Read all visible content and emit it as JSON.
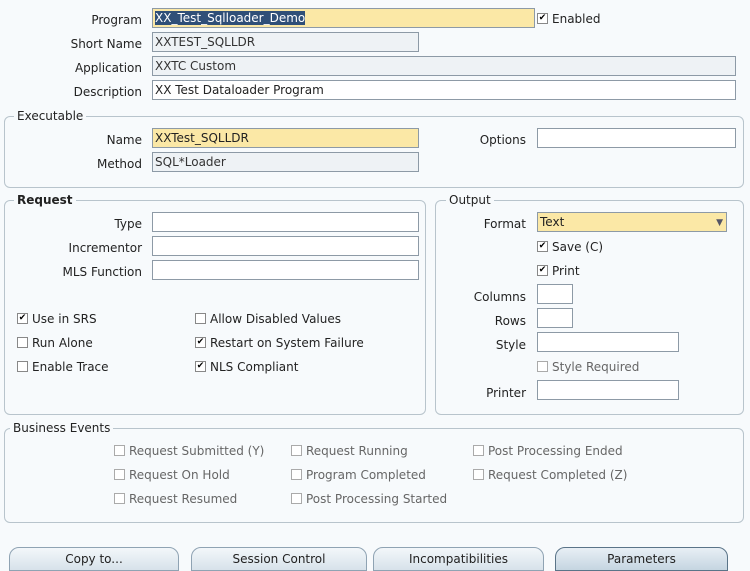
{
  "program": {
    "program_label": "Program",
    "program_value": "XX_Test_Sqlloader_Demo",
    "enabled_label": "Enabled",
    "enabled_checked": true,
    "short_name_label": "Short Name",
    "short_name_value": "XXTEST_SQLLDR",
    "application_label": "Application",
    "application_value": "XXTC Custom",
    "description_label": "Description",
    "description_value": "XX Test Dataloader Program"
  },
  "executable": {
    "title": "Executable",
    "name_label": "Name",
    "name_value": "XXTest_SQLLDR",
    "options_label": "Options",
    "options_value": "",
    "method_label": "Method",
    "method_value": "SQL*Loader"
  },
  "request": {
    "title": "Request",
    "type_label": "Type",
    "type_value": "",
    "incrementor_label": "Incrementor",
    "incrementor_value": "",
    "mls_label": "MLS Function",
    "mls_value": "",
    "checkboxes": {
      "use_in_srs": "Use in SRS",
      "run_alone": "Run Alone",
      "enable_trace": "Enable Trace",
      "allow_disabled": "Allow Disabled Values",
      "restart": "Restart on System Failure",
      "nls": "NLS Compliant"
    }
  },
  "output": {
    "title": "Output",
    "format_label": "Format",
    "format_value": "Text",
    "save_label": "Save (C)",
    "print_label": "Print",
    "columns_label": "Columns",
    "rows_label": "Rows",
    "style_label": "Style",
    "style_required_label": "Style Required",
    "printer_label": "Printer"
  },
  "business_events": {
    "title": "Business Events",
    "request_submitted": "Request Submitted (Y)",
    "request_on_hold": "Request On Hold",
    "request_resumed": "Request Resumed",
    "request_running": "Request Running",
    "program_completed": "Program Completed",
    "post_processing_started": "Post Processing Started",
    "post_processing_ended": "Post Processing Ended",
    "request_completed": "Request Completed (Z)"
  },
  "buttons": {
    "copy_to": "Copy to...",
    "session_control": "Session Control",
    "incompatibilities": "Incompatibilities",
    "parameters": "Parameters"
  },
  "colors": {
    "required_field": "#fbe8a6",
    "selection": "#2f4f78"
  }
}
